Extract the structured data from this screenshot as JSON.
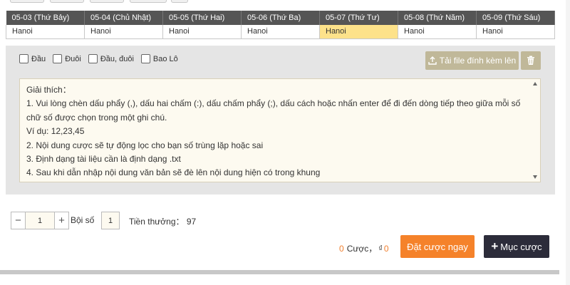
{
  "dates": {
    "headers": [
      "05-03 (Thứ Bảy)",
      "05-04 (Chủ Nhật)",
      "05-05 (Thứ Hai)",
      "05-06 (Thứ Ba)",
      "05-07 (Thứ Tư)",
      "05-08 (Thứ Năm)",
      "05-09 (Thứ Sáu)"
    ],
    "cells": [
      "Hanoi",
      "Hanoi",
      "Hanoi",
      "Hanoi",
      "Hanoi",
      "Hanoi",
      "Hanoi"
    ],
    "active_index": 4
  },
  "options": {
    "checkboxes": [
      "Đầu",
      "Đuôi",
      "Đầu, đuôi",
      "Bao Lô"
    ]
  },
  "upload": {
    "label": "Tải file đính kèm lên",
    "icon": "upload-icon"
  },
  "trash": {
    "icon": "trash-icon"
  },
  "notes": {
    "lines": [
      "Giải thích：",
      "1. Vui lòng chèn dấu phẩy (,), dấu hai chấm (:), dấu chấm phẩy (;), dấu cách hoặc nhấn enter để đi đến dòng tiếp theo giữa mỗi số chữ số được chọn trong một ghi chú.",
      "Ví dụ: 12,23,45",
      "2. Nội dung cược sẽ tự động lọc cho bạn số trùng lặp hoặc sai",
      "3. Định dạng tài liệu cần là định dạng .txt",
      "4. Sau khi dẫn nhập nội dung văn bản sẽ đè lên nội dung hiện có trong khung"
    ]
  },
  "stepper": {
    "value": "1",
    "minus": "−",
    "plus": "+"
  },
  "multiplier": {
    "label": "Bội số",
    "value": "1"
  },
  "reward": {
    "label": "Tiền thưởng：",
    "value": "97"
  },
  "summary": {
    "bets_count": "0",
    "bets_label": "Cược，",
    "currency_symbol": "₫",
    "amount": "0"
  },
  "actions": {
    "place_bet": "Đặt cược ngay",
    "bet_list": "Mục cược",
    "bet_list_plus": "+"
  },
  "colors": {
    "header_bg": "#555555",
    "active_cell": "#fde28a",
    "panel_bg": "#e5e5e5",
    "upload_btn": "#c0b899",
    "place_bet": "#f5822a",
    "bet_list": "#2c2c3a",
    "accent_orange": "#f08030"
  }
}
